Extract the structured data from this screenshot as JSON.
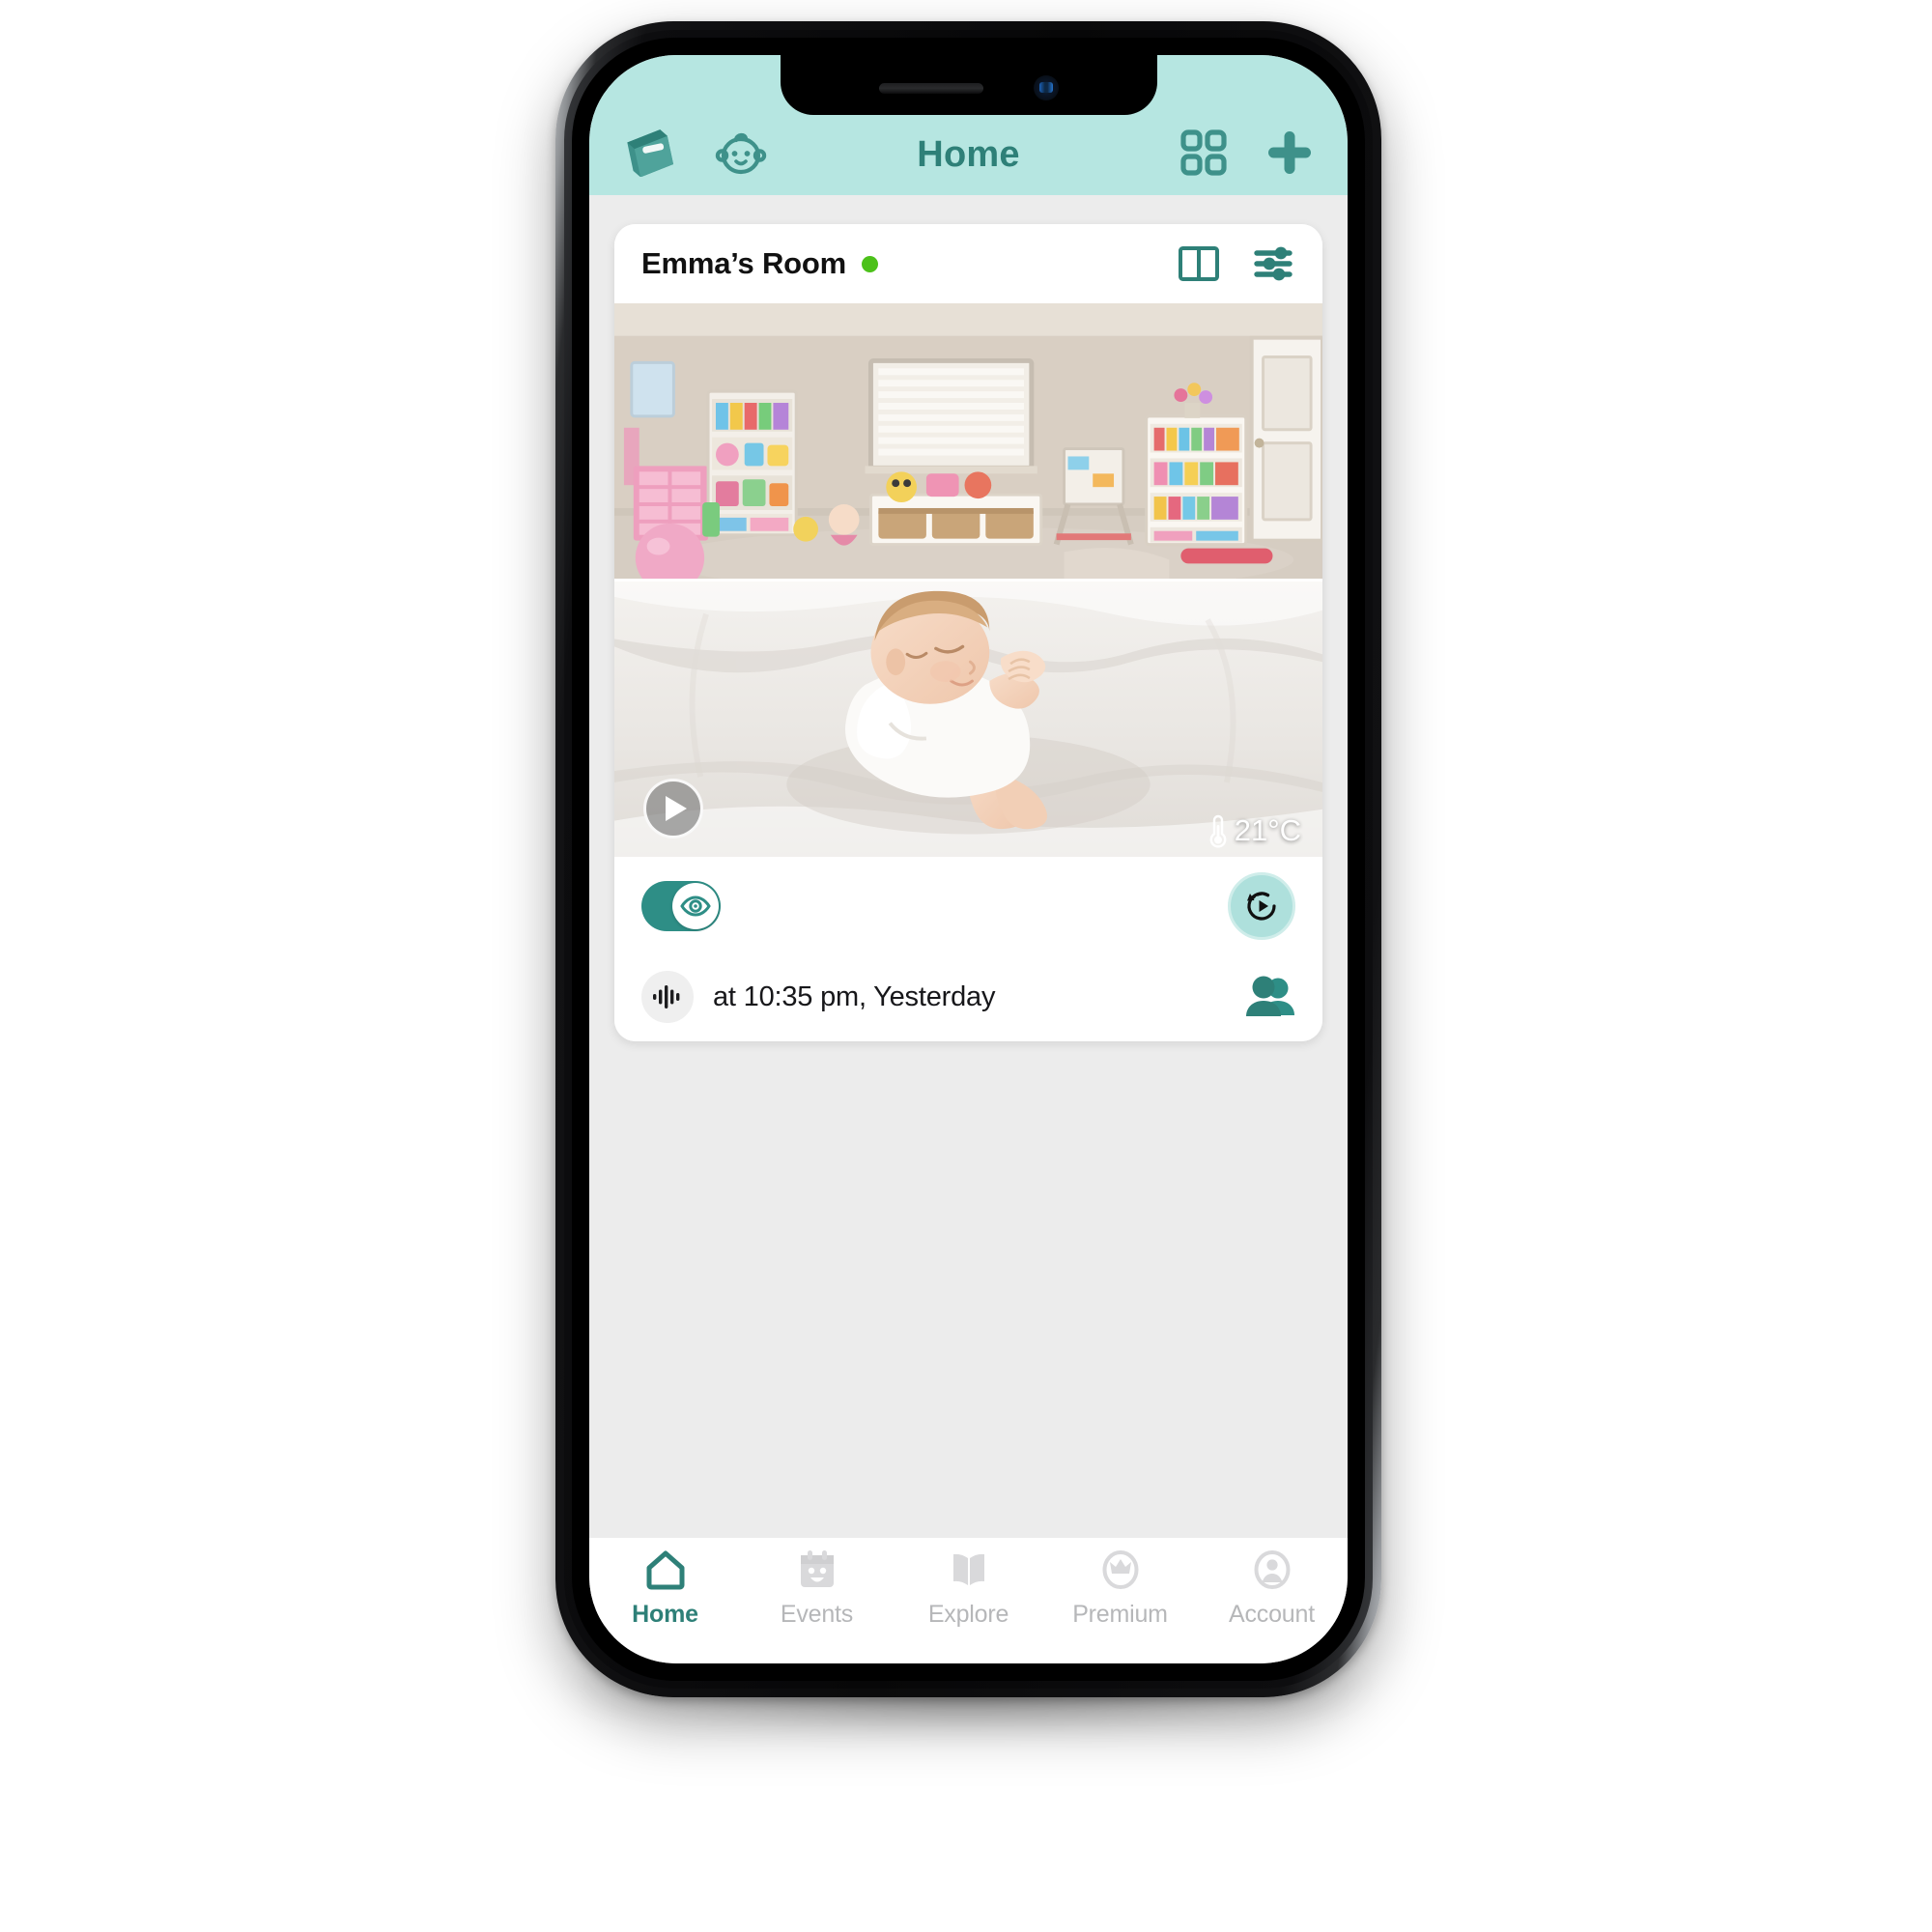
{
  "app": {
    "header": {
      "title": "Home",
      "accent_color": "#2E8078",
      "background_color": "#B6E6E1",
      "left_icons": [
        {
          "name": "book-icon",
          "label": "Diary"
        },
        {
          "name": "baby-face-icon",
          "label": "Baby"
        }
      ],
      "right_icons": [
        {
          "name": "grid-icon",
          "label": "Grid view"
        },
        {
          "name": "plus-icon",
          "label": "Add device"
        }
      ]
    },
    "body_background": "#ECECEC",
    "camera_card": {
      "room_name": "Emma’s Room",
      "status": {
        "name": "online",
        "color": "#4CC11A"
      },
      "actions": [
        {
          "name": "split-view-icon",
          "label": "Split view"
        },
        {
          "name": "sliders-icon",
          "label": "Settings"
        }
      ],
      "streams": [
        {
          "name": "room-wide-view",
          "label": "Nursery wide view"
        },
        {
          "name": "crib-close-view",
          "label": "Crib close-up"
        }
      ],
      "play_button_label": "Play",
      "temperature": {
        "value": "21°C",
        "icon": "thermometer-icon"
      },
      "controls": {
        "watch_toggle": {
          "label": "Watch",
          "state": "on",
          "icon": "eye-icon",
          "on_color": "#2E8E86"
        },
        "replay_button": {
          "label": "Replay",
          "icon": "replay-icon",
          "fill": "#AEE0DC"
        }
      },
      "last_event": {
        "icon": "audio-waveform-icon",
        "text": "at 10:35 pm, Yesterday"
      },
      "shared_with": {
        "icon": "people-icon",
        "label": "Shared with"
      }
    },
    "tabbar": {
      "active_color": "#2E8078",
      "inactive_color": "#B6B7B9",
      "tabs": [
        {
          "label": "Home",
          "icon": "house-icon",
          "active": true
        },
        {
          "label": "Events",
          "icon": "calendar-face-icon",
          "active": false
        },
        {
          "label": "Explore",
          "icon": "open-book-icon",
          "active": false
        },
        {
          "label": "Premium",
          "icon": "crown-circle-icon",
          "active": false
        },
        {
          "label": "Account",
          "icon": "person-circle-icon",
          "active": false
        }
      ]
    }
  },
  "device": {
    "notch": {
      "speaker": "earpiece-speaker",
      "camera": "front-camera"
    },
    "buttons": [
      "silent-switch",
      "volume-up",
      "volume-down",
      "power"
    ]
  }
}
